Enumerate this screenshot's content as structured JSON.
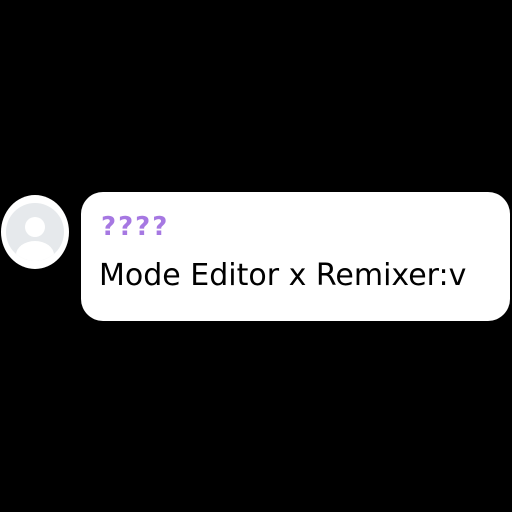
{
  "message": {
    "avatar_icon": "default-user-avatar",
    "sender_name": "????",
    "text": "Mode Editor x Remixer:v",
    "colors": {
      "background": "#000000",
      "bubble": "#ffffff",
      "sender_name": "#a678e2",
      "text": "#000000",
      "avatar_bg": "#e6e9ec",
      "avatar_silhouette": "#ffffff"
    }
  }
}
